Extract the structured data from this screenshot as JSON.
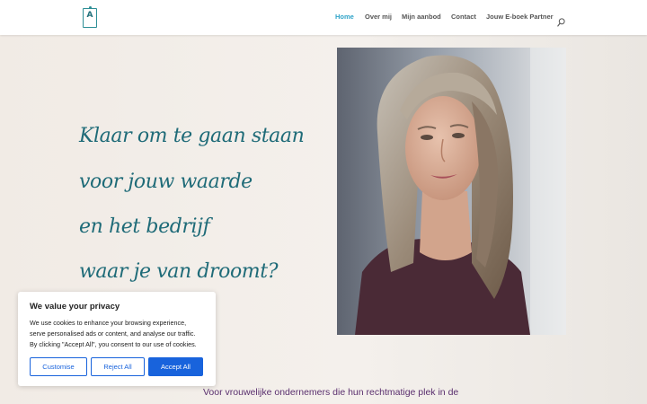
{
  "logo": {
    "letter": "A",
    "subtext": ""
  },
  "nav": {
    "items": [
      {
        "label": "Home",
        "active": true
      },
      {
        "label": "Over mij",
        "active": false
      },
      {
        "label": "Mijn aanbod",
        "active": false
      },
      {
        "label": "Contact",
        "active": false
      },
      {
        "label": "Jouw E-boek Partner",
        "active": false
      }
    ],
    "search_icon": "search-icon"
  },
  "hero": {
    "headline_lines": [
      "Klaar om te gaan staan",
      "voor jouw waarde",
      "en het bedrijf",
      "waar je van droomt?"
    ],
    "subtext": "Voor vrouwelijke ondernemers die hun rechtmatige plek in de"
  },
  "cookie_banner": {
    "title": "We value your privacy",
    "body_lines": [
      "We use cookies to enhance your browsing experience,",
      "serve personalised ads or content, and analyse our traffic.",
      "By clicking \"Accept All\", you consent to our use of cookies."
    ],
    "customise_label": "Customise",
    "reject_label": "Reject All",
    "accept_label": "Accept All"
  },
  "colors": {
    "accent": "#2ea3c8",
    "headline": "#1f6b78",
    "subtext": "#5a2f6e",
    "cookie_button": "#1863dc"
  }
}
